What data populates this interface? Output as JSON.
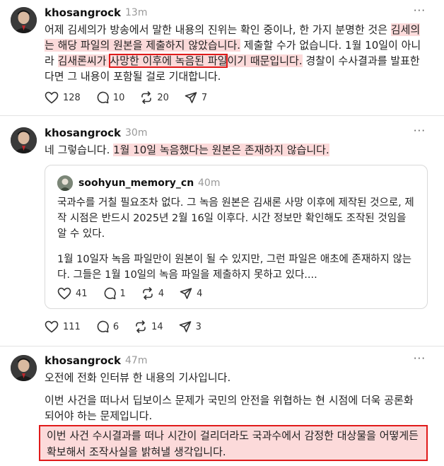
{
  "posts": [
    {
      "username": "khosangrock",
      "time": "13m",
      "more": "···",
      "segments": [
        {
          "t": "어제 김세의가 방송에서 말한 내용의 진위는 확인 중이나, 한 가지 분명한 것은 ",
          "s": "plain"
        },
        {
          "t": "김세의는 해당 파일의 원본을 제출하지 않았습니다.",
          "s": "hl"
        },
        {
          "t": " 제출할 수가 없습니다. 1월 10일이 아니라 ",
          "s": "plain"
        },
        {
          "t": "김새론씨가 ",
          "s": "hl"
        },
        {
          "t": "사망한 이후에 녹음된 파일",
          "s": "box"
        },
        {
          "t": "이기 때문입니다.",
          "s": "hl"
        },
        {
          "t": " 경찰이 수사결과를 발표한다면 그 내용이 포함될 걸로 기대합니다.",
          "s": "plain"
        }
      ],
      "stats": {
        "likes": "128",
        "comments": "10",
        "reposts": "20",
        "shares": "7"
      }
    },
    {
      "username": "khosangrock",
      "time": "30m",
      "more": "···",
      "segments": [
        {
          "t": "네 그렇습니다. ",
          "s": "plain"
        },
        {
          "t": "1월 10일 녹음했다는 원본은 존재하지 않습니다.",
          "s": "hl"
        }
      ],
      "quote": {
        "username": "soohyun_memory_cn",
        "time": "40m",
        "paragraphs": [
          "국과수를 거칠 필요조차 없다. 그 녹음 원본은 김새론 사망 이후에 제작된 것으로, 제작 시점은 반드시 2025년 2월 16일 이후다. 시간 정보만 확인해도 조작된 것임을 알 수 있다.",
          "1월 10일자 녹음 파일만이 원본이 될 수 있지만, 그런 파일은 애초에 존재하지 않는다. 그들은 1월 10일의 녹음 파일을 제출하지 못하고 있다...."
        ],
        "stats": {
          "likes": "41",
          "comments": "1",
          "reposts": "4",
          "shares": "4"
        }
      },
      "stats": {
        "likes": "111",
        "comments": "6",
        "reposts": "14",
        "shares": "3"
      }
    },
    {
      "username": "khosangrock",
      "time": "47m",
      "more": "···",
      "paragraphs": [
        "오전에 전화 인터뷰 한 내용의 기사입니다.",
        "이번 사건을 떠나서 딥보이스 문제가 국민의 안전을 위협하는 현 시점에 더욱 공론화되어야 하는 문제입니다."
      ],
      "highlight_paragraph": "이번 사건 수시결과를 떠나 시간이 걸리더라도 국과수에서 감정한 대상물을 어떻게든 확보해서 조작사실을 밝혀낼 생각입니다."
    }
  ]
}
